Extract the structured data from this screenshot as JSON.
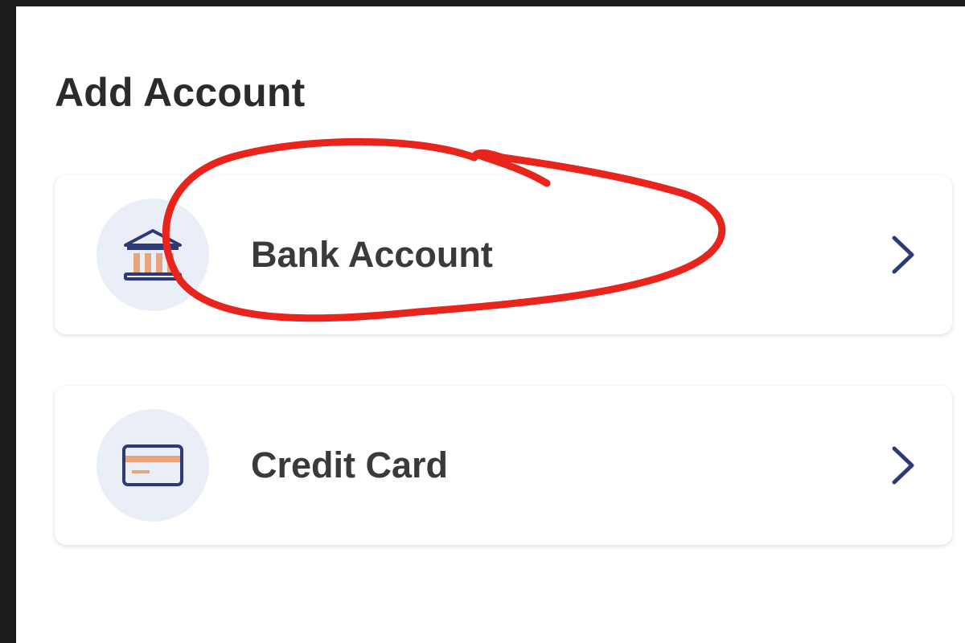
{
  "page": {
    "title": "Add Account"
  },
  "options": [
    {
      "label": "Bank Account",
      "icon": "bank-icon"
    },
    {
      "label": "Credit Card",
      "icon": "credit-card-icon"
    }
  ],
  "colors": {
    "navy": "#2e3a75",
    "accent_orange": "#e8a57c",
    "icon_bg": "#e9eef7",
    "annotation_red": "#e8241c"
  }
}
